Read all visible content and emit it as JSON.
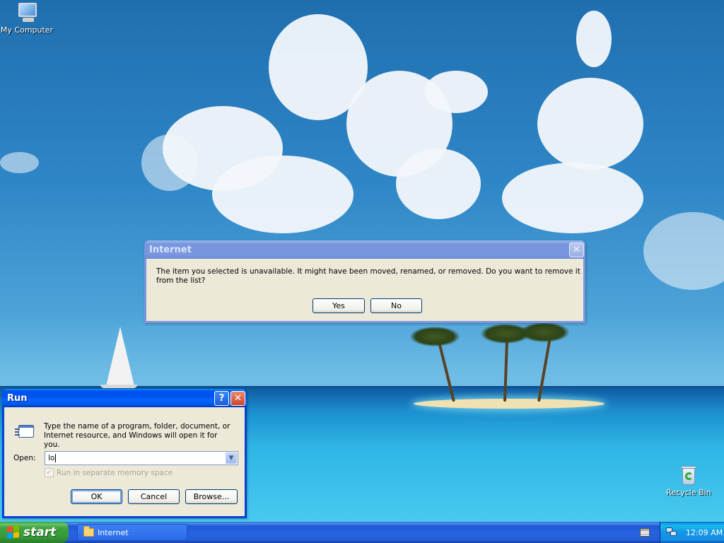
{
  "desktop": {
    "icons": [
      {
        "label": "My Computer",
        "icon": "my-computer-icon"
      },
      {
        "label": "Recycle Bin",
        "icon": "recycle-bin-icon"
      }
    ]
  },
  "internet_dialog": {
    "title": "Internet",
    "message": "The item you selected is unavailable.  It might have been moved, renamed, or removed.  Do you want to remove it from the list?",
    "yes_label": "Yes",
    "no_label": "No",
    "close_glyph": "✕"
  },
  "run_dialog": {
    "title": "Run",
    "help_glyph": "?",
    "close_glyph": "✕",
    "description": "Type the name of a program, folder, document, or Internet resource, and Windows will open it for you.",
    "open_label": "Open:",
    "open_value": "lo",
    "dropdown_glyph": "▼",
    "checkbox_label": "Run in separate memory space",
    "checkbox_glyph": "✓",
    "ok_label": "OK",
    "cancel_label": "Cancel",
    "browse_label": "Browse..."
  },
  "taskbar": {
    "start_label": "start",
    "tasks": [
      {
        "label": "Internet",
        "icon": "folder-icon"
      }
    ],
    "clock": "12:09 AM"
  },
  "colors": {
    "title_active": "#0053ee",
    "title_inactive": "#7a96df",
    "start_green": "#3ea33e",
    "tray_blue": "#1495e6",
    "dialog_face": "#ece9d8"
  }
}
